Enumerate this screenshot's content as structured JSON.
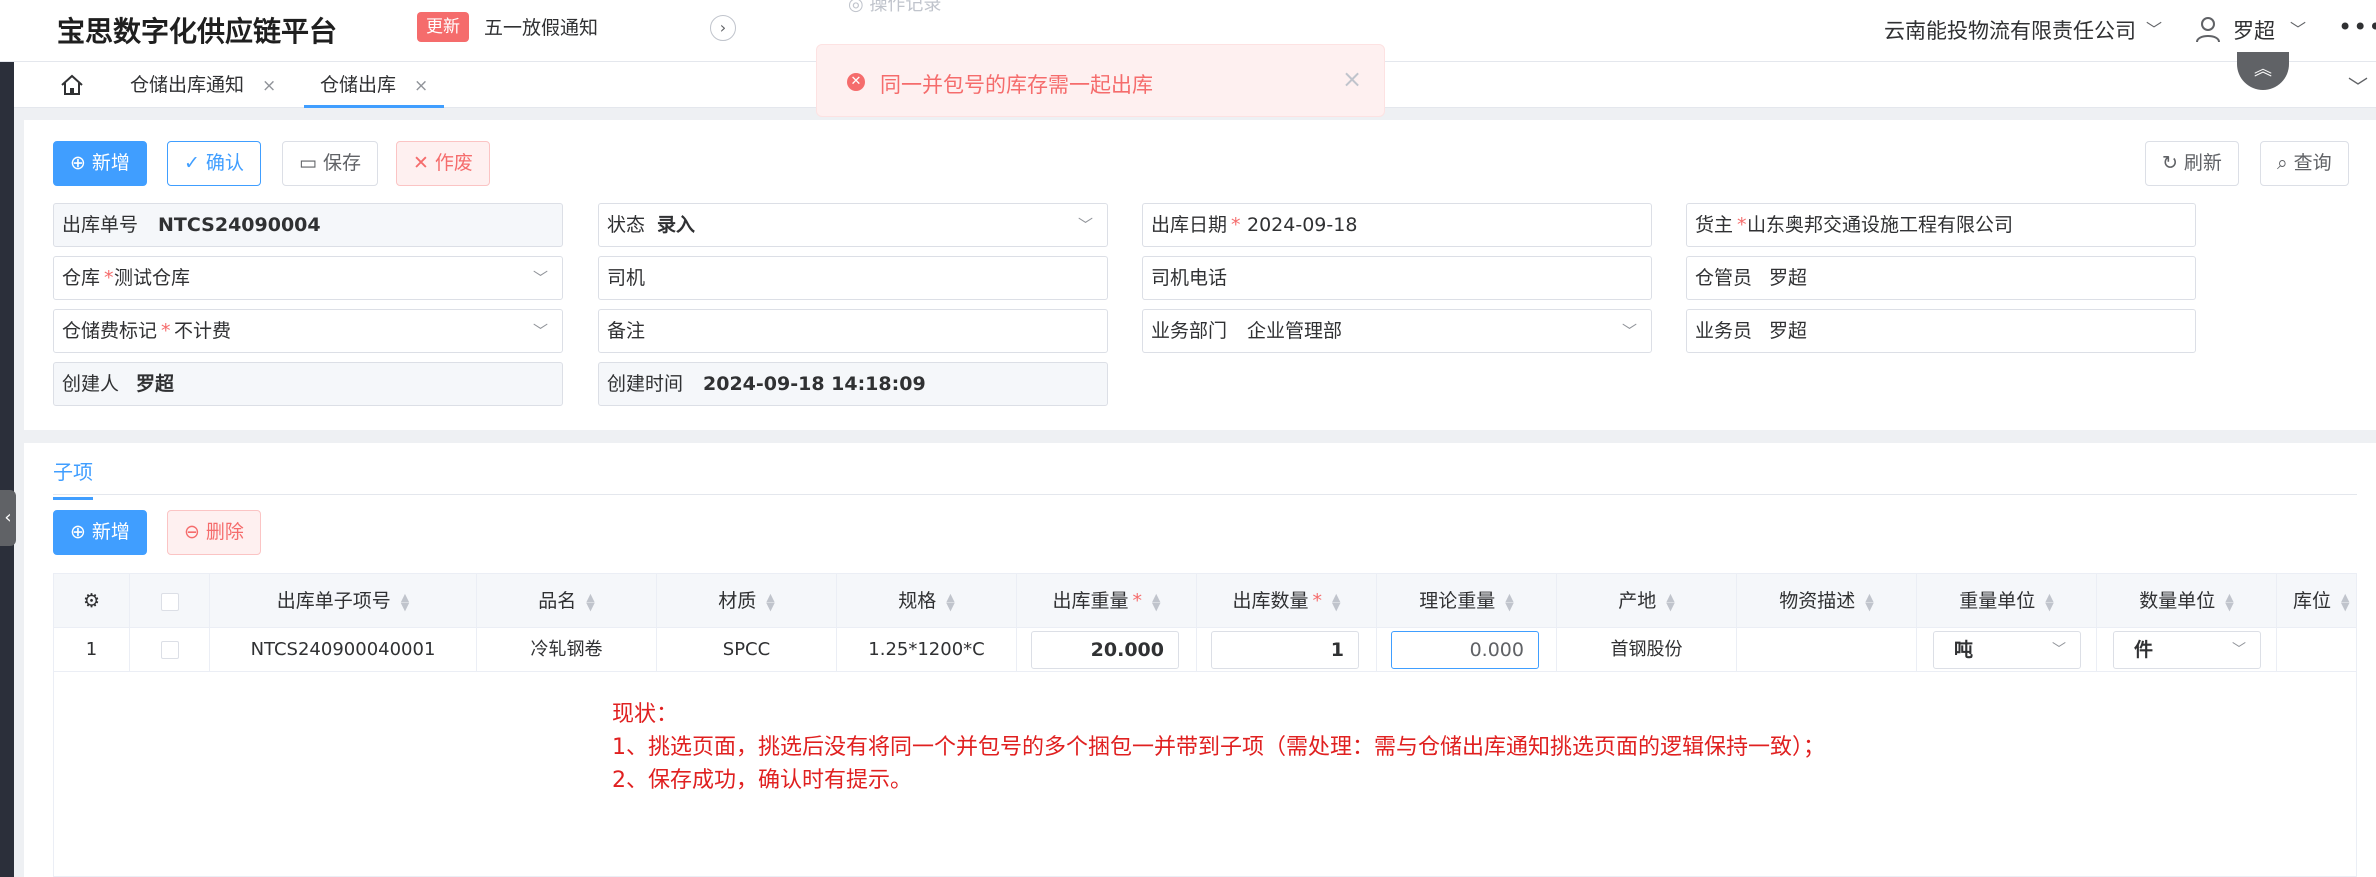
{
  "header": {
    "brand": "宝思数字化供应链平台",
    "update_badge": "更新",
    "notice": "五一放假通知",
    "next_icon": "chevron-right-icon",
    "company": "云南能投物流有限责任公司",
    "user": "罗超",
    "ghost_text": "◎ 操作记录"
  },
  "tabs": {
    "items": [
      {
        "label": "仓储出库通知"
      },
      {
        "label": "仓储出库"
      }
    ],
    "active_index": 1,
    "close_glyph": "×"
  },
  "toast": {
    "type": "error",
    "message": "同一并包号的库存需一起出库",
    "close_glyph": "×"
  },
  "toolbar": {
    "add": "新增",
    "confirm": "确认",
    "save": "保存",
    "void": "作废",
    "refresh": "刷新",
    "query": "查询"
  },
  "form": {
    "out_no": {
      "label": "出库单号",
      "value": "NTCS24090004"
    },
    "status": {
      "label": "状态",
      "value": "录入"
    },
    "out_date": {
      "label": "出库日期",
      "value": "2024-09-18"
    },
    "owner": {
      "label": "货主",
      "value": "山东奥邦交通设施工程有限公司"
    },
    "warehouse": {
      "label": "仓库",
      "value": "测试仓库"
    },
    "driver": {
      "label": "司机",
      "value": ""
    },
    "driver_phone": {
      "label": "司机电话",
      "value": ""
    },
    "keeper": {
      "label": "仓管员",
      "value": "罗超"
    },
    "fee_flag": {
      "label": "仓储费标记",
      "value": "不计费"
    },
    "remark": {
      "label": "备注",
      "value": ""
    },
    "department": {
      "label": "业务部门",
      "value": "企业管理部"
    },
    "salesman": {
      "label": "业务员",
      "value": "罗超"
    },
    "creator": {
      "label": "创建人",
      "value": "罗超"
    },
    "created_at": {
      "label": "创建时间",
      "value": "2024-09-18 14:18:09"
    },
    "required_mark": "*"
  },
  "detail": {
    "section_label": "子项",
    "add": "新增",
    "delete": "删除",
    "columns": [
      "出库单子项号",
      "品名",
      "材质",
      "规格",
      "出库重量",
      "出库数量",
      "理论重量",
      "产地",
      "物资描述",
      "重量单位",
      "数量单位",
      "库位"
    ],
    "rows": [
      {
        "index": "1",
        "item_no": "NTCS240900040001",
        "product": "冷轧钢卷",
        "material": "SPCC",
        "spec": "1.25*1200*C",
        "out_weight": "20.000",
        "out_qty": "1",
        "theory_weight": "0.000",
        "origin": "首钢股份",
        "description": "",
        "weight_unit": "吨",
        "qty_unit": "件",
        "location": ""
      }
    ]
  },
  "annotation": {
    "lines": [
      "现状：",
      "1、挑选页面，挑选后没有将同一个并包号的多个捆包一并带到子项（需处理：需与仓储出库通知挑选页面的逻辑保持一致）；",
      "2、保存成功，确认时有提示。"
    ]
  },
  "colors": {
    "primary": "#409eff",
    "danger": "#f56c6c",
    "annotation": "#e02020",
    "toast_bg": "#fef0f0"
  }
}
